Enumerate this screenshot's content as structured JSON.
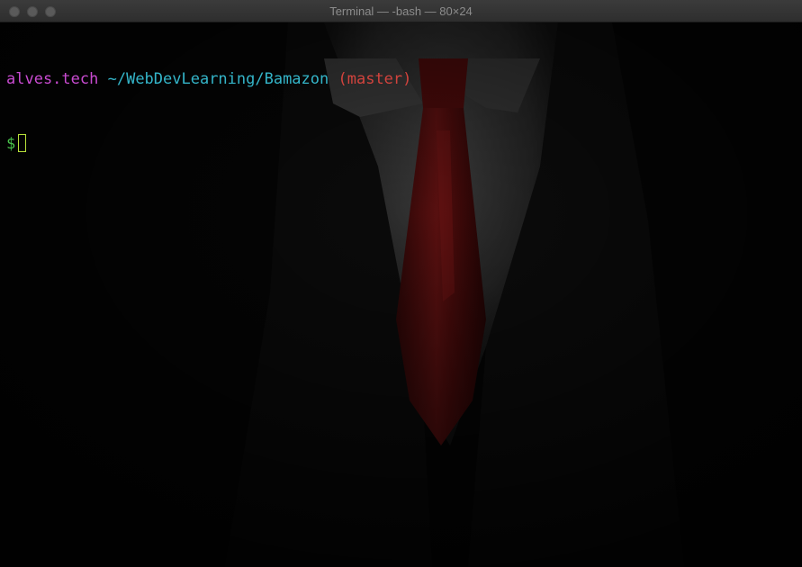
{
  "window": {
    "title": "Terminal — -bash — 80×24"
  },
  "terminal": {
    "host": "alves.tech",
    "path": "~/WebDevLearning/Bamazon",
    "branch": "(master)",
    "prompt_symbol": "$"
  },
  "colors": {
    "host": "#c94bd1",
    "path": "#34b5c9",
    "branch": "#d2433d",
    "prompt": "#48c24b",
    "cursor": "#b9e23a",
    "background": "#000000"
  }
}
